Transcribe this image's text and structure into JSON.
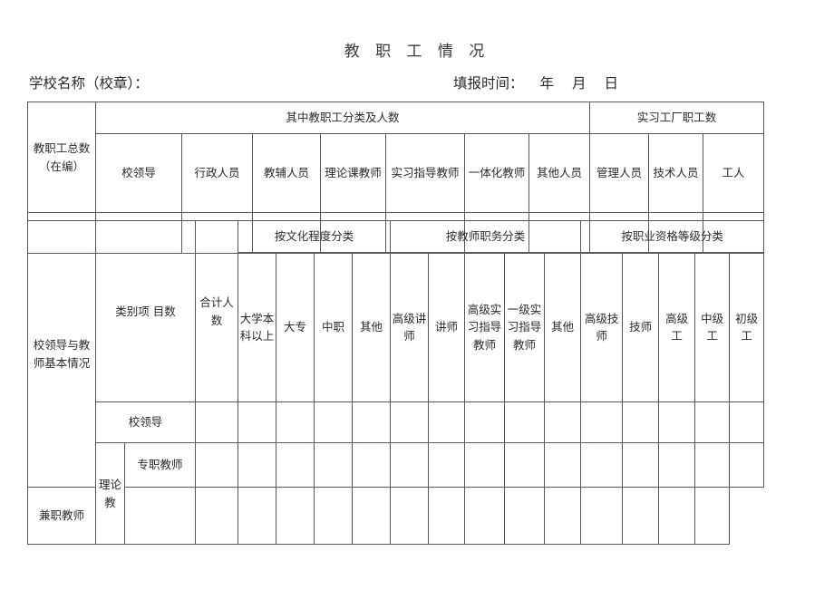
{
  "document": {
    "title": "教 职 工 情 况",
    "school_label": "学校名称（校章）：",
    "date_label": "填报时间：",
    "date_year": "年",
    "date_month": "月",
    "date_day": "日"
  },
  "table_staff": {
    "row_label": "教职工总数（在编）",
    "group_a": "其中教职工分类及人数",
    "group_b": "实习工厂职工数",
    "columns_a": [
      "校领导",
      "行政人员",
      "教辅人员",
      "理论课教师",
      "实习指导教师",
      "一体化教师",
      "其他人员"
    ],
    "columns_b": [
      "管理人员",
      "技术人员",
      "工人"
    ],
    "values": [
      "",
      "",
      "",
      "",
      "",
      "",
      "",
      "",
      "",
      "",
      ""
    ]
  },
  "table_leader": {
    "section_label": "校领导与教师基本情况",
    "category_label": "类别项 目数",
    "total_label": "合计人数",
    "group_culture": "按文化程度分类",
    "group_duty": "按教师职务分类",
    "group_qual": "按职业资格等级分类",
    "columns_culture": [
      "大学本科以上",
      "大专",
      "中职",
      "其他"
    ],
    "columns_duty": [
      "高级讲师",
      "讲师",
      "高级实习指导教师",
      "一级实习指导教师",
      "其他"
    ],
    "columns_qual": [
      "高级技师",
      "技师",
      "高级工",
      "中级工",
      "初级工"
    ],
    "rows": [
      {
        "name": "校领导",
        "group": "",
        "values": [
          "",
          "",
          "",
          "",
          "",
          "",
          "",
          "",
          "",
          "",
          "",
          "",
          "",
          "",
          ""
        ]
      },
      {
        "name": "专职教师",
        "group": "理论教",
        "values": [
          "",
          "",
          "",
          "",
          "",
          "",
          "",
          "",
          "",
          "",
          "",
          "",
          "",
          "",
          ""
        ]
      },
      {
        "name": "兼职教师",
        "group": "",
        "values": [
          "",
          "",
          "",
          "",
          "",
          "",
          "",
          "",
          "",
          "",
          "",
          "",
          "",
          "",
          ""
        ]
      }
    ],
    "group_vertical_label": "理论教"
  }
}
